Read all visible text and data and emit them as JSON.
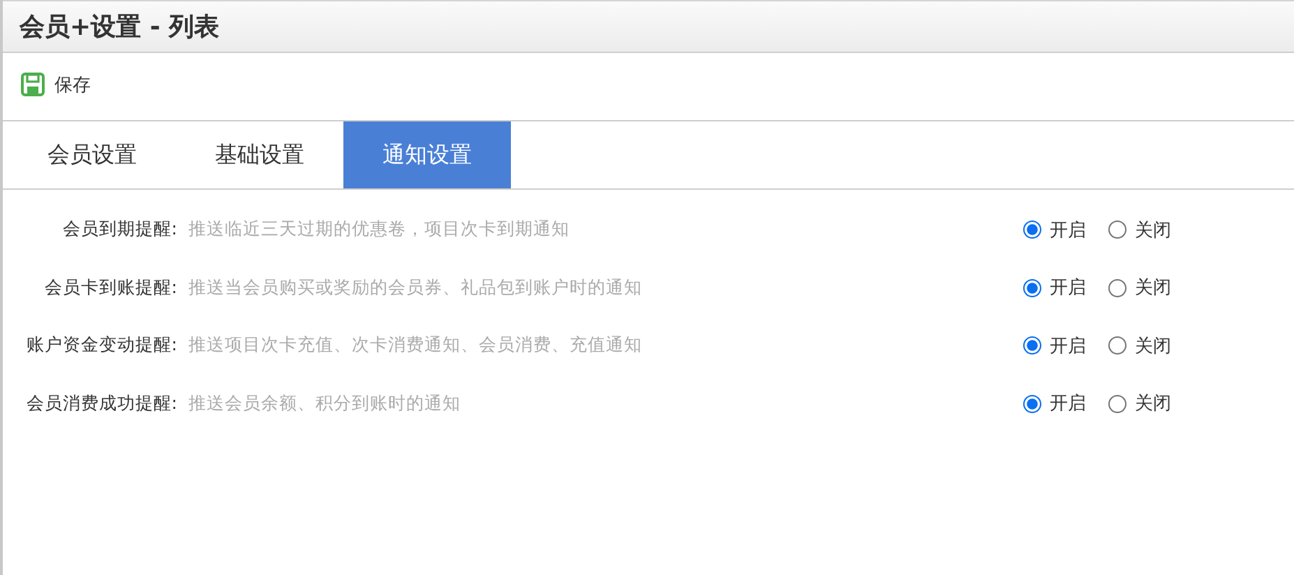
{
  "window": {
    "title": "会员+设置 - 列表"
  },
  "toolbar": {
    "save": "保存"
  },
  "tabs": [
    {
      "label": "会员设置",
      "selected": false
    },
    {
      "label": "基础设置",
      "selected": false
    },
    {
      "label": "通知设置",
      "selected": true
    }
  ],
  "settings": [
    {
      "label": "会员到期提醒:",
      "description": "推送临近三天过期的优惠卷，项目次卡到期通知",
      "options": [
        {
          "label": "开启",
          "selected": true
        },
        {
          "label": "关闭",
          "selected": false
        }
      ]
    },
    {
      "label": "会员卡到账提醒:",
      "description": "推送当会员购买或奖励的会员券、礼品包到账户时的通知",
      "options": [
        {
          "label": "开启",
          "selected": true
        },
        {
          "label": "关闭",
          "selected": false
        }
      ]
    },
    {
      "label": "账户资金变动提醒:",
      "description": "推送项目次卡充值、次卡消费通知、会员消费、充值通知",
      "options": [
        {
          "label": "开启",
          "selected": true
        },
        {
          "label": "关闭",
          "selected": false
        }
      ]
    },
    {
      "label": "会员消费成功提醒:",
      "description": "推送会员余额、积分到账时的通知",
      "options": [
        {
          "label": "开启",
          "selected": true
        },
        {
          "label": "关闭",
          "selected": false
        }
      ]
    }
  ]
}
